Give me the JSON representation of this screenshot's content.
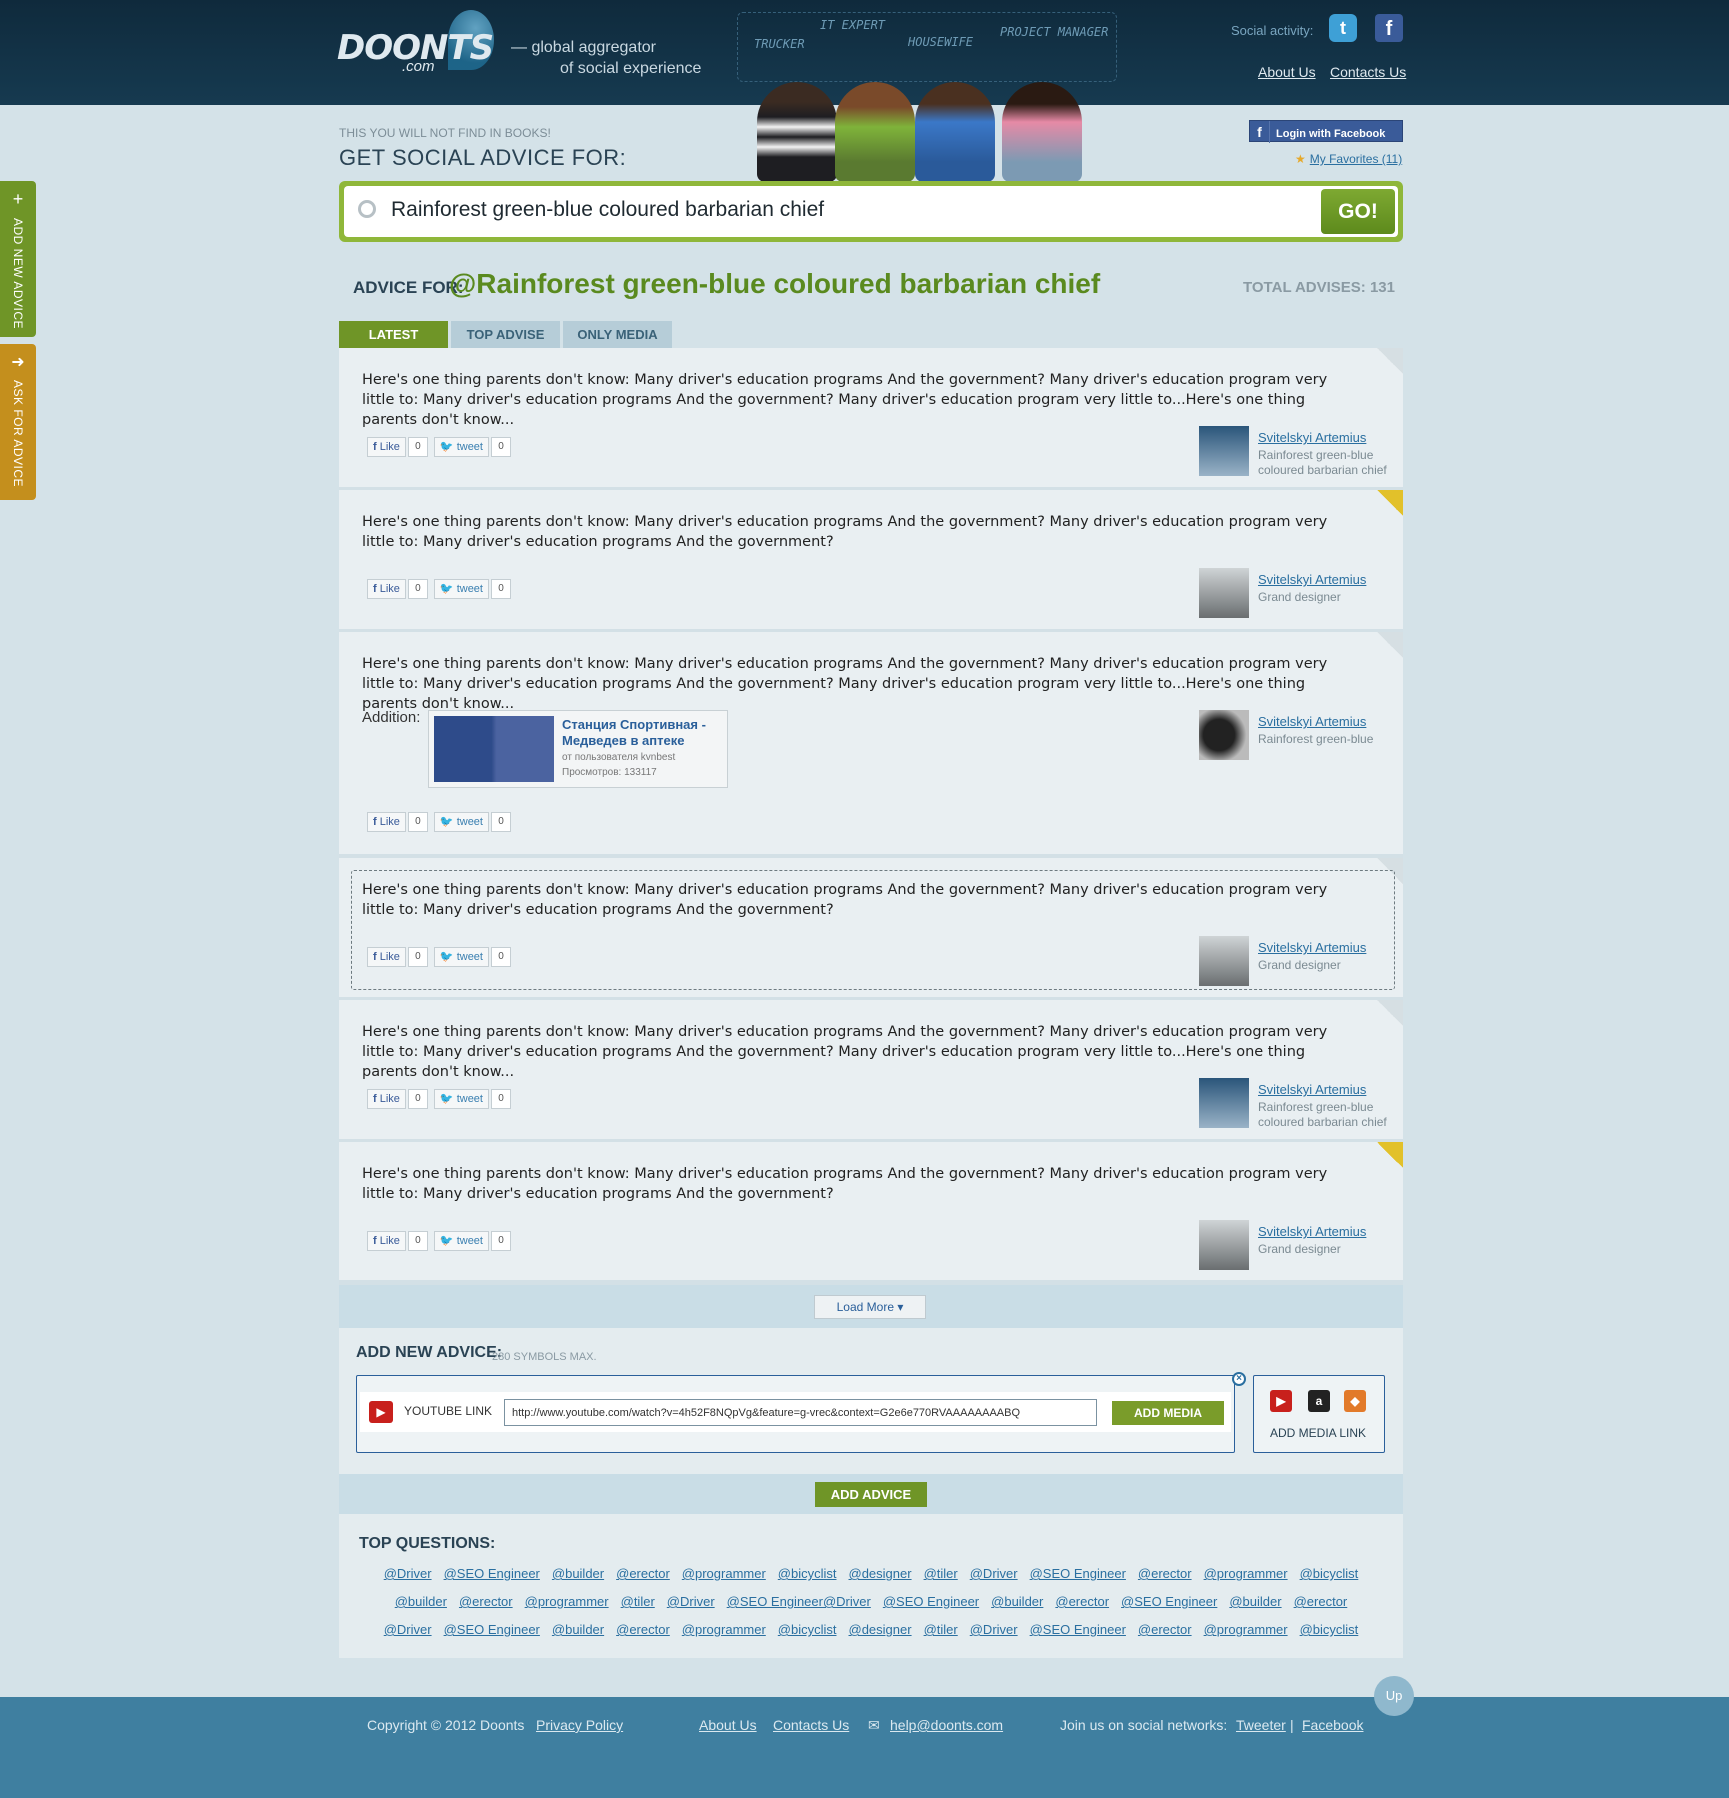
{
  "header": {
    "logo": "DOONTS",
    "logo_sub": ".com",
    "tagline_1": "— global aggregator",
    "tagline_2": "of social experience",
    "roles": [
      "TRUCKER",
      "IT EXPERT",
      "HOUSEWIFE",
      "PROJECT MANAGER"
    ],
    "social_label": "Social activity:",
    "nav": [
      "About Us",
      "Contacts Us"
    ]
  },
  "side_tabs": {
    "add": "ADD NEW ADVICE",
    "ask": "ASK FOR ADVICE"
  },
  "hero": {
    "pre_title": "THIS YOU WILL NOT FIND IN BOOKS!",
    "title": "GET SOCIAL ADVICE FOR:",
    "login_fb": "Login with Facebook",
    "favorites": "My Favorites (11)"
  },
  "search": {
    "query": "Rainforest green-blue coloured barbarian chief",
    "go": "GO!"
  },
  "advice": {
    "label": "ADVICE FOR:",
    "topic": "@Rainforest green-blue coloured barbarian chief",
    "total": "TOTAL ADVISES: 131",
    "tabs": [
      "LATEST",
      "TOP ADVISE",
      "ONLY MEDIA"
    ],
    "items": [
      {
        "text": "Here's one thing parents don't know: Many driver's education programs  And the government? Many driver's education program very little to: Many driver's education programs And the government? Many driver's education program very little to...Here's one thing parents don't know...",
        "author": "Svitelskyi Artemius",
        "role": "Rainforest green-blue coloured barbarian chief",
        "like": "Like",
        "like_count": "0",
        "tweet": "tweet",
        "tweet_count": "0"
      },
      {
        "text": "Here's one thing parents don't know: Many driver's education programs  And the government? Many driver's education program very little to: Many driver's education programs And the government?",
        "author": "Svitelskyi Artemius",
        "role": "Grand designer",
        "like": "Like",
        "like_count": "0",
        "tweet": "tweet",
        "tweet_count": "0"
      },
      {
        "text": "Here's one thing parents don't know: Many driver's education programs  And the government? Many driver's education program very little to: Many driver's education programs And the government? Many driver's education program very little to...Here's one thing parents don't know...",
        "author": "Svitelskyi Artemius",
        "role": "Rainforest green-blue",
        "addition_label": "Addition:",
        "media_title": "Станция Спортивная - Медведев в аптеке",
        "media_by": "от пользователя kvnbest",
        "media_views": "Просмотров: 133117",
        "like": "Like",
        "like_count": "0",
        "tweet": "tweet",
        "tweet_count": "0"
      },
      {
        "text": "Here's one thing parents don't know: Many driver's education programs  And the government? Many driver's education program very little to: Many driver's education programs And the government?",
        "author": "Svitelskyi Artemius",
        "role": "Grand designer",
        "like": "Like",
        "like_count": "0",
        "tweet": "tweet",
        "tweet_count": "0"
      },
      {
        "text": "Here's one thing parents don't know: Many driver's education programs  And the government? Many driver's education program very little to: Many driver's education programs And the government? Many driver's education program very little to...Here's one thing parents don't know...",
        "author": "Svitelskyi Artemius",
        "role": "Rainforest green-blue coloured barbarian chief",
        "like": "Like",
        "like_count": "0",
        "tweet": "tweet",
        "tweet_count": "0"
      },
      {
        "text": "Here's one thing parents don't know: Many driver's education programs  And the government? Many driver's education program very little to: Many driver's education programs And the government?",
        "author": "Svitelskyi Artemius",
        "role": "Grand designer",
        "like": "Like",
        "like_count": "0",
        "tweet": "tweet",
        "tweet_count": "0"
      }
    ],
    "load_more": "Load More ▾"
  },
  "add_new": {
    "title": "ADD NEW ADVICE:",
    "max": "280 SYMBOLS MAX.",
    "yt_label": "YOUTUBE LINK",
    "yt_value": "http://www.youtube.com/watch?v=4h52F8NQpVg&feature=g-vrec&context=G2e6e770RVAAAAAAAABQ",
    "add_media": "ADD MEDIA",
    "media_link": "ADD MEDIA LINK",
    "add_advice": "ADD ADVICE"
  },
  "top_questions": {
    "title": "TOP QUESTIONS:",
    "rows": [
      [
        "@Driver",
        "@SEO Engineer",
        "@builder",
        "@erector",
        "@programmer",
        "@bicyclist",
        "@designer",
        "@tiler",
        "@Driver",
        "@SEO Engineer",
        "@erector",
        "@programmer",
        "@bicyclist"
      ],
      [
        "@builder",
        "@erector",
        "@programmer",
        "@tiler",
        "@Driver",
        "@SEO Engineer@Driver",
        "@SEO Engineer",
        "@builder",
        "@erector",
        "@SEO Engineer",
        "@builder",
        "@erector"
      ],
      [
        "@Driver",
        "@SEO Engineer",
        "@builder",
        "@erector",
        "@programmer",
        "@bicyclist",
        "@designer",
        "@tiler",
        "@Driver",
        "@SEO Engineer",
        "@erector",
        "@programmer",
        "@bicyclist"
      ]
    ]
  },
  "footer": {
    "copyright": "Copyright © 2012 Doonts",
    "privacy": "Privacy Policy",
    "about": "About Us",
    "contacts": "Contacts Us",
    "email": "help@doonts.com",
    "join": "Join us on social networks:",
    "tweeter": "Tweeter",
    "sep": "|",
    "facebook": "Facebook",
    "up": "Up"
  }
}
